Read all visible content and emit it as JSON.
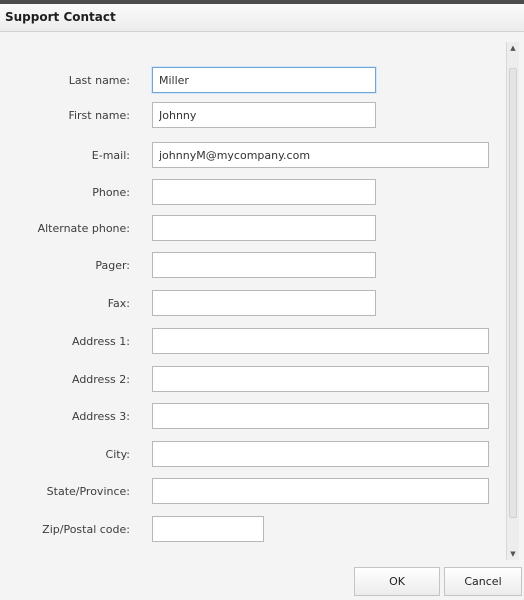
{
  "dialog": {
    "title": "Support Contact"
  },
  "form": {
    "fields": [
      {
        "label": "Last name:",
        "value": "Miller"
      },
      {
        "label": "First name:",
        "value": "Johnny"
      },
      {
        "label": "E-mail:",
        "value": "johnnyM@mycompany.com"
      },
      {
        "label": "Phone:",
        "value": ""
      },
      {
        "label": "Alternate phone:",
        "value": ""
      },
      {
        "label": "Pager:",
        "value": ""
      },
      {
        "label": "Fax:",
        "value": ""
      },
      {
        "label": "Address 1:",
        "value": ""
      },
      {
        "label": "Address 2:",
        "value": ""
      },
      {
        "label": "Address 3:",
        "value": ""
      },
      {
        "label": "City:",
        "value": ""
      },
      {
        "label": "State/Province:",
        "value": ""
      },
      {
        "label": "Zip/Postal code:",
        "value": ""
      }
    ]
  },
  "buttons": {
    "ok_label": "OK",
    "cancel_label": "Cancel"
  },
  "icons": {
    "scroll_up": "scroll-up-icon",
    "scroll_down": "scroll-down-icon"
  }
}
